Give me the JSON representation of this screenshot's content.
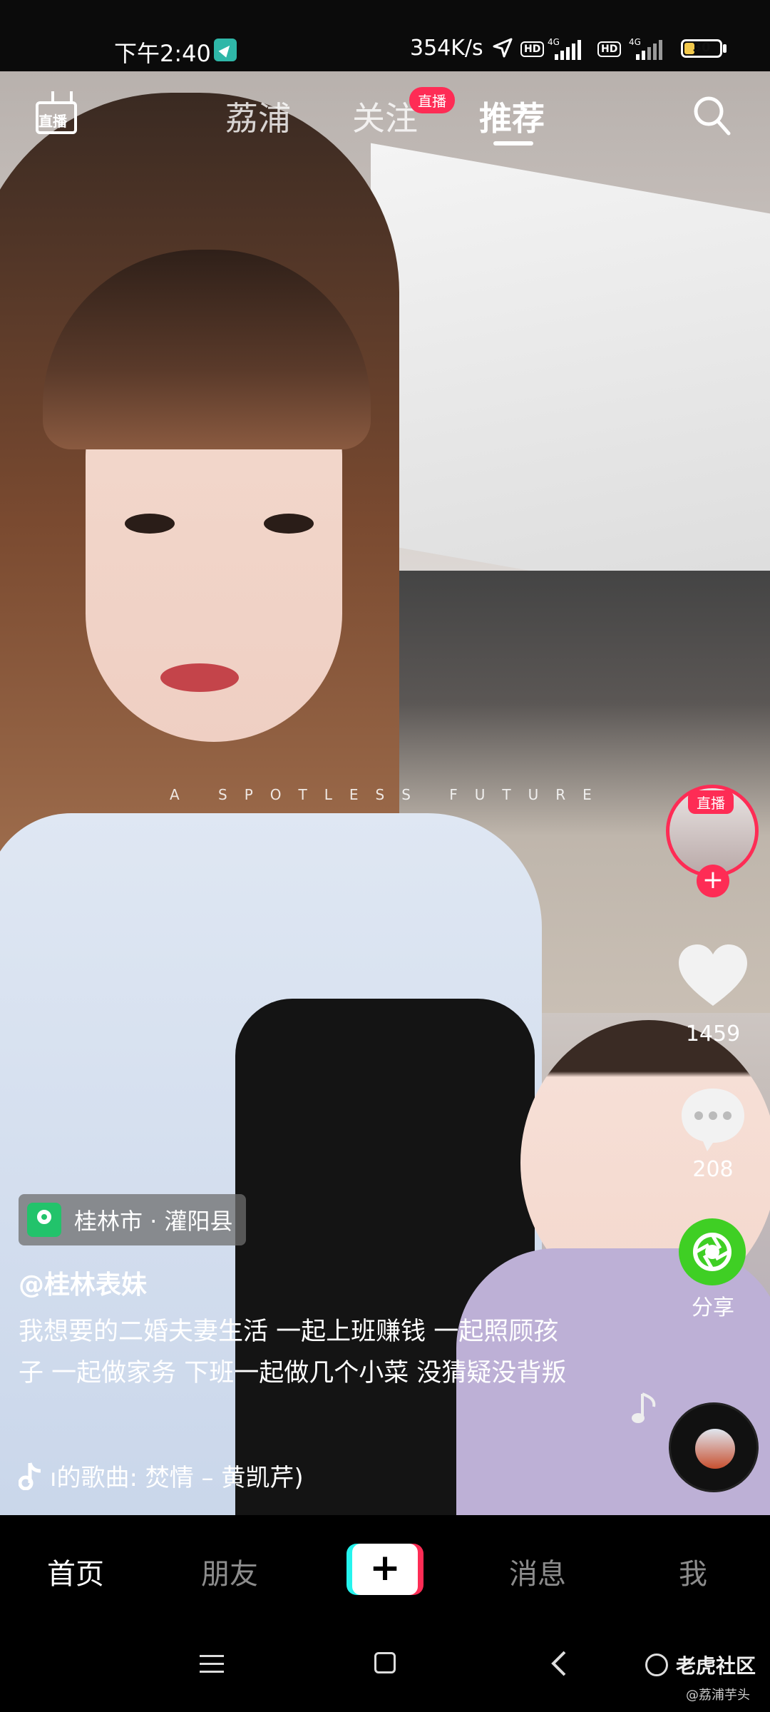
{
  "status_bar": {
    "time": "下午2:40",
    "net_speed": "354K/s",
    "hd1": "HD",
    "net1": "4G",
    "hd2": "HD",
    "net2": "4G",
    "battery": "30",
    "battery_level": 0.3
  },
  "top_nav": {
    "live_icon_label": "直播",
    "tabs": [
      {
        "label": "荔浦",
        "active": false
      },
      {
        "label": "关注",
        "active": false,
        "badge": "直播"
      },
      {
        "label": "推荐",
        "active": true
      }
    ]
  },
  "video": {
    "overlay_text": "A SPOTLESS FUTURE"
  },
  "sidebar": {
    "avatar_live_badge": "直播",
    "follow_button": "+",
    "like_count": "1459",
    "comment_count": "208",
    "share_label": "分享"
  },
  "post": {
    "location": "桂林市 · 灌阳县",
    "username": "@桂林表妹",
    "caption": "我想要的二婚夫妻生活 一起上班赚钱 一起照顾孩子 一起做家务 下班一起做几个小菜 没猜疑没背叛",
    "music": "ı的歌曲: 焚情 – 黄凯芹)"
  },
  "bottom_nav": {
    "items": [
      {
        "label": "首页",
        "active": true
      },
      {
        "label": "朋友",
        "active": false
      },
      {
        "label": "+",
        "active": false
      },
      {
        "label": "消息",
        "active": false
      },
      {
        "label": "我",
        "active": false
      }
    ]
  },
  "watermark": {
    "name": "老虎社区",
    "handle": "@荔浦芋头"
  },
  "colors": {
    "accent": "#fe2c55",
    "share_green": "#3fcf24",
    "location_green": "#22c36b",
    "cyan": "#25f4ee"
  }
}
